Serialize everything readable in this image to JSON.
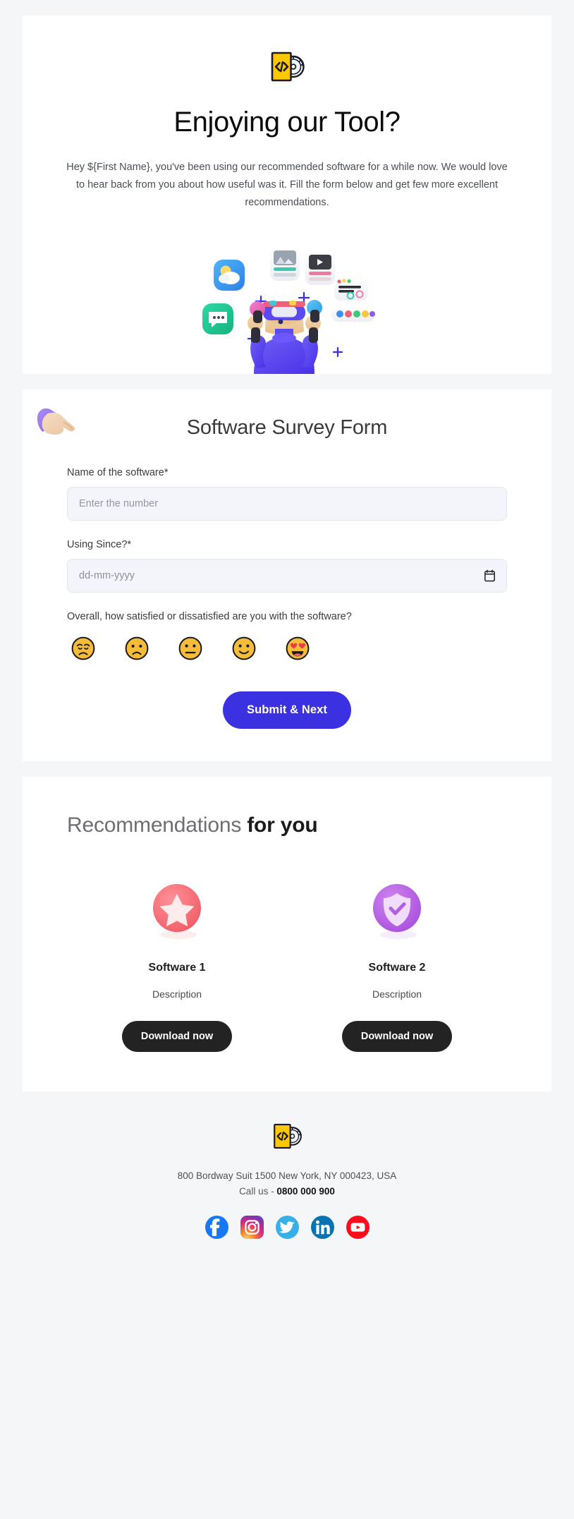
{
  "brand": {
    "logo_icon": "code-disc-logo-icon",
    "accent_primary": "#3b31e0",
    "accent_dark": "#232323",
    "logo_yellow": "#fcc800",
    "page_background": "#f5f6f7",
    "card_background": "#ffffff",
    "input_background": "#f4f5fb"
  },
  "hero": {
    "title": "Enjoying our Tool?",
    "body": "Hey ${First Name}, you've been using our recommended software for a while now. We would love to hear back from you about how useful was it. Fill the form below and get few more excellent recommendations.",
    "illustration_name": "juggling-app-icons-illustration"
  },
  "form": {
    "hand_icon": "pointing-hand-icon",
    "title": "Software Survey Form",
    "fields": [
      {
        "label": "Name of the software*",
        "placeholder": "Enter the number",
        "value": "",
        "type": "text"
      },
      {
        "label": "Using Since?*",
        "placeholder": "dd-mm-yyyy",
        "value": "",
        "type": "date",
        "icon": "calendar-icon"
      }
    ],
    "satisfaction": {
      "question": "Overall, how satisfied or dissatisfied are you with the software?",
      "options": [
        {
          "name": "disappointed-face-emoji",
          "glyph": "😔",
          "value": 1
        },
        {
          "name": "frowning-face-emoji",
          "glyph": "🙁",
          "value": 2
        },
        {
          "name": "neutral-face-emoji",
          "glyph": "😐",
          "value": 3
        },
        {
          "name": "slightly-smiling-face-emoji",
          "glyph": "🙂",
          "value": 4
        },
        {
          "name": "smiling-face-with-hearts-emoji",
          "glyph": "😍",
          "value": 5
        }
      ]
    },
    "submit_label": "Submit & Next"
  },
  "recommendations": {
    "title_light": "Recommendations",
    "title_bold": "for you",
    "items": [
      {
        "icon": "star-badge-icon",
        "icon_color": "#f4666c",
        "name": "Software 1",
        "description": "Description",
        "button_label": "Download now"
      },
      {
        "icon": "shield-check-badge-icon",
        "icon_color": "#b65fe0",
        "name": "Software 2",
        "description": "Description",
        "button_label": "Download now"
      }
    ]
  },
  "footer": {
    "logo_icon": "code-disc-logo-icon",
    "address": "800 Bordway Suit 1500 New York, NY 000423, USA",
    "call_prefix": "Call us - ",
    "phone": "0800 000 900",
    "social": [
      {
        "name": "facebook-icon",
        "label": "Facebook",
        "color": "#1877f2"
      },
      {
        "name": "instagram-icon",
        "label": "Instagram",
        "color": "#e1306c"
      },
      {
        "name": "twitter-icon",
        "label": "Twitter",
        "color": "#1da1f2"
      },
      {
        "name": "linkedin-icon",
        "label": "LinkedIn",
        "color": "#0a66c2"
      },
      {
        "name": "youtube-icon",
        "label": "YouTube",
        "color": "#ff0000"
      }
    ]
  }
}
